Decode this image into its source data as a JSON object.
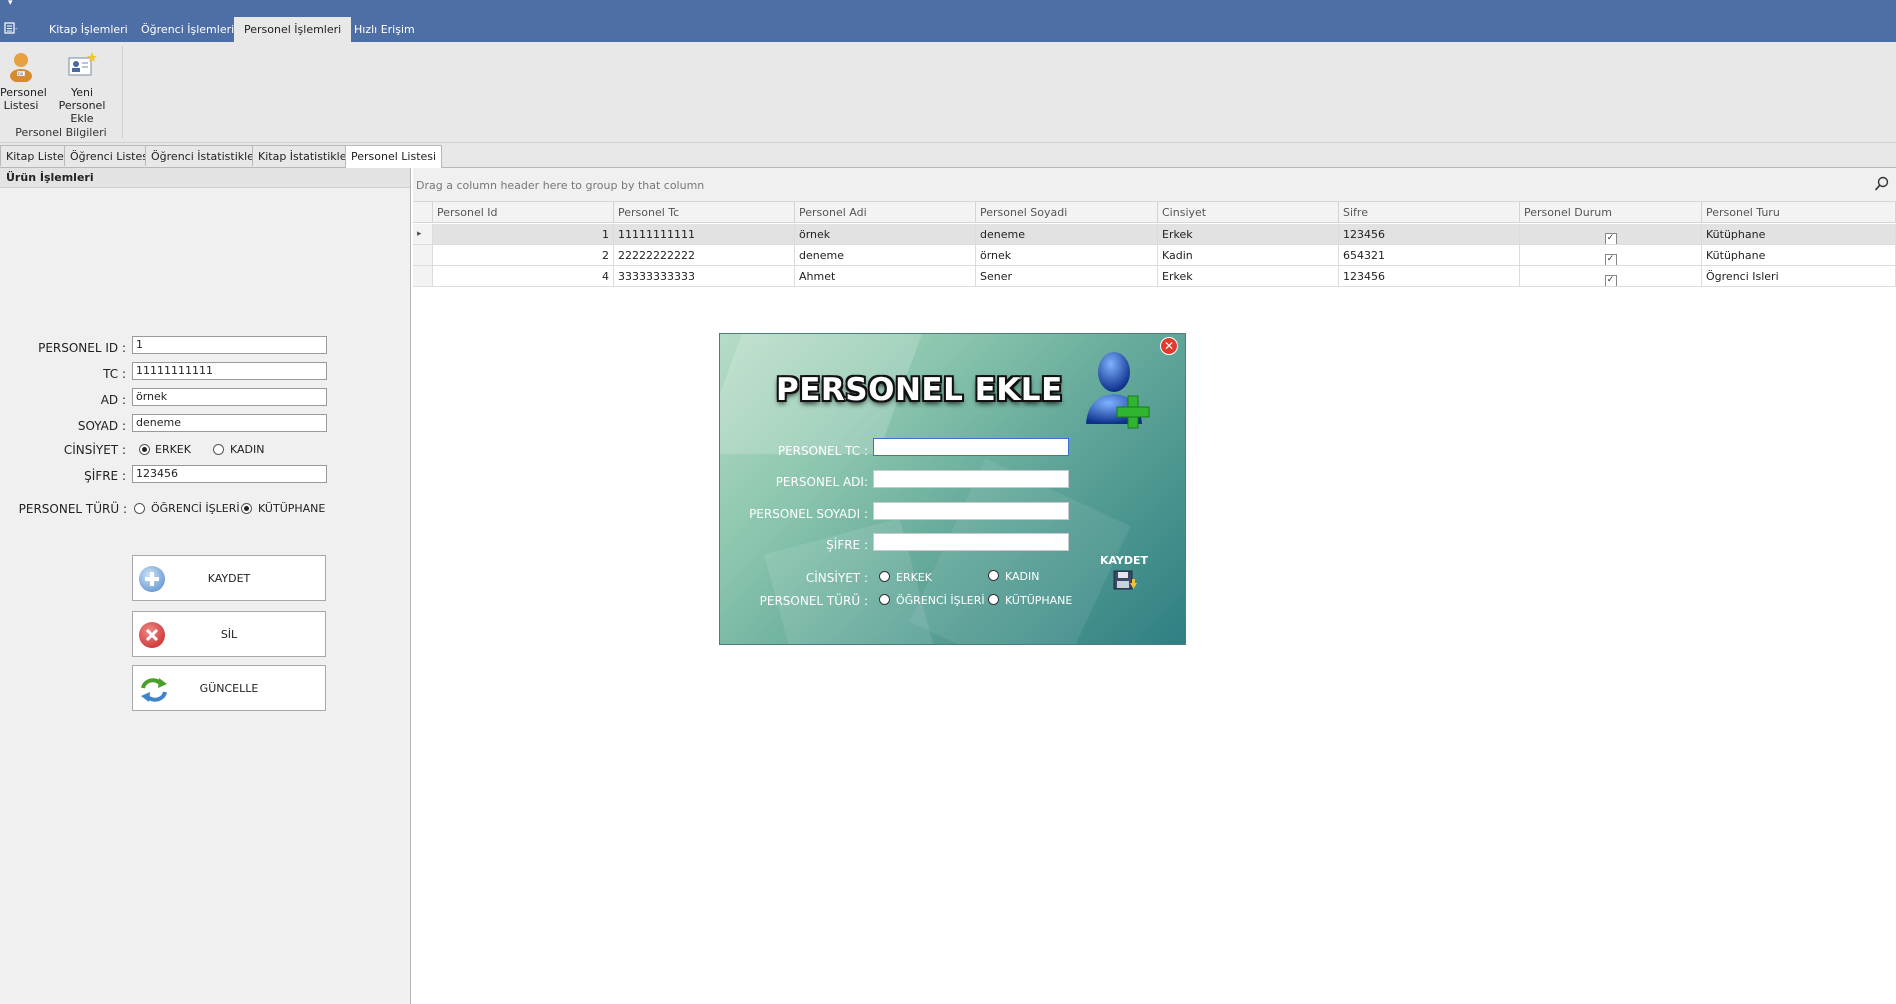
{
  "ribbon_tabs": [
    {
      "label": "Kitap İşlemleri",
      "active": false
    },
    {
      "label": "Öğrenci İşlemleri",
      "active": false
    },
    {
      "label": "Personel İşlemleri",
      "active": true
    },
    {
      "label": "Hızlı Erişim",
      "active": false
    }
  ],
  "ribbon": {
    "personel_listesi": "Personel\nListesi",
    "yeni_personel": "Yeni Personel\nEkle",
    "group_label": "Personel Bilgileri"
  },
  "doc_tabs": [
    {
      "label": "Kitap Listesi",
      "active": false
    },
    {
      "label": "Öğrenci Listesi",
      "active": false
    },
    {
      "label": "Öğrenci İstatistikleri",
      "active": false
    },
    {
      "label": "Kitap İstatistikleri",
      "active": false
    },
    {
      "label": "Personel Listesi",
      "active": true
    }
  ],
  "left_panel": {
    "title": "Ürün İşlemleri",
    "labels": {
      "id": "PERSONEL ID :",
      "tc": "TC :",
      "ad": "AD :",
      "soyad": "SOYAD :",
      "cinsiyet": "CİNSİYET :",
      "sifre": "ŞİFRE :",
      "turu": "PERSONEL TÜRÜ :"
    },
    "values": {
      "id": "1",
      "tc": "11111111111",
      "ad": "örnek",
      "soyad": "deneme",
      "sifre": "123456"
    },
    "gender_options": {
      "erkek": "ERKEK",
      "kadin": "KADIN",
      "selected": "erkek"
    },
    "type_options": {
      "ogrenci": "ÖĞRENCİ İŞLERİ",
      "kutuphane": "KÜTÜPHANE",
      "selected": "kutuphane"
    },
    "buttons": {
      "kaydet": "KAYDET",
      "sil": "SİL",
      "guncelle": "GÜNCELLE"
    }
  },
  "grid": {
    "group_hint": "Drag a column header here to group by that column",
    "columns": [
      "Personel Id",
      "Personel Tc",
      "Personel Adi",
      "Personel Soyadi",
      "Cinsiyet",
      "Sifre",
      "Personel Durum",
      "Personel Turu"
    ],
    "rows": [
      [
        "1",
        "11111111111",
        "örnek",
        "deneme",
        "Erkek",
        "123456",
        "✓",
        "Kütüphane"
      ],
      [
        "2",
        "22222222222",
        "deneme",
        "örnek",
        "Kadin",
        "654321",
        "✓",
        "Kütüphane"
      ],
      [
        "4",
        "33333333333",
        "Ahmet",
        "Sener",
        "Erkek",
        "123456",
        "✓",
        "Ögrenci Isleri"
      ]
    ]
  },
  "dialog": {
    "title": "PERSONEL EKLE",
    "close": "✕",
    "labels": {
      "tc": "PERSONEL TC :",
      "adi": "PERSONEL ADI:",
      "soyadi": "PERSONEL SOYADI :",
      "sifre": "ŞİFRE :",
      "cinsiyet": "CİNSİYET :",
      "turu": "PERSONEL TÜRÜ :"
    },
    "gender_options": {
      "erkek": "ERKEK",
      "kadin": "KADIN"
    },
    "type_options": {
      "ogrenci": "ÖĞRENCİ İŞLERİ",
      "kutuphane": "KÜTÜPHANE"
    },
    "save_label": "KAYDET"
  },
  "colors": {
    "title_bar": "#4d6fa6",
    "ribbon": "#e8e8e8",
    "dialog_gradient_start": "#b7dcc6",
    "dialog_gradient_end": "#2f7f83"
  }
}
